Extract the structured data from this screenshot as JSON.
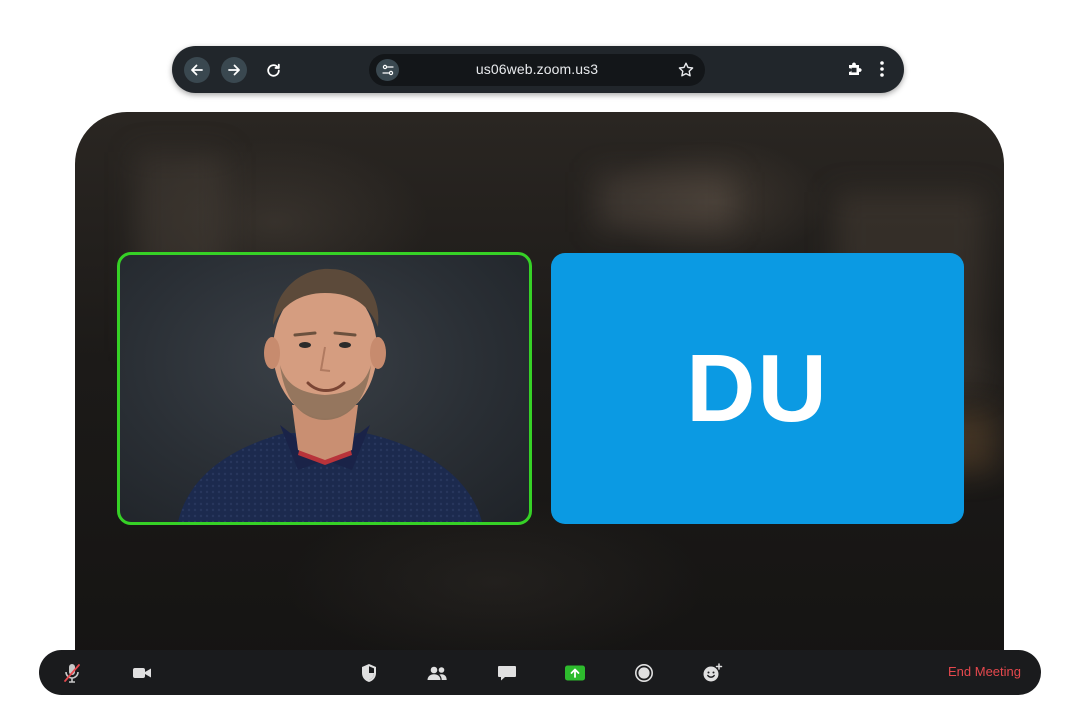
{
  "browser": {
    "url": "us06web.zoom.us3",
    "back_icon": "arrow-left-icon",
    "forward_icon": "arrow-right-icon",
    "reload_icon": "reload-icon",
    "site_info_icon": "tune-icon",
    "bookmark_icon": "star-icon",
    "extensions_icon": "puzzle-icon",
    "menu_icon": "kebab-menu-icon"
  },
  "meeting": {
    "participants": [
      {
        "type": "video",
        "active_speaker": true,
        "border_color": "#36d126"
      },
      {
        "type": "avatar",
        "initials": "DU",
        "color": "#0b9ae3"
      }
    ]
  },
  "toolbar": {
    "left": [
      "mic-muted-icon",
      "video-camera-icon"
    ],
    "center": [
      "security-shield-icon",
      "participants-icon",
      "chat-icon",
      "share-screen-icon",
      "record-icon",
      "reactions-icon"
    ],
    "share_color": "#2dbb2d",
    "end_label": "End Meeting",
    "end_color": "#e5484d"
  }
}
